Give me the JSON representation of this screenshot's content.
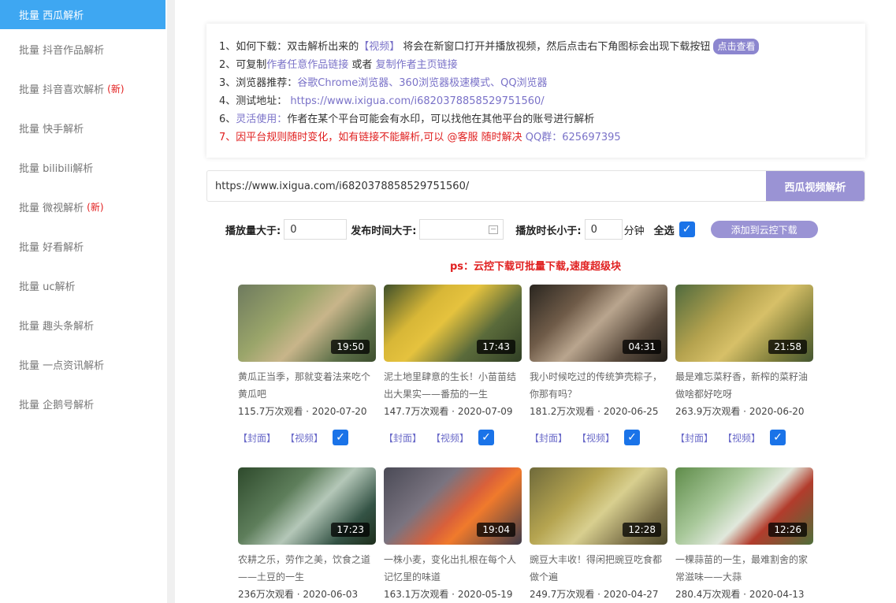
{
  "sidebar": {
    "items": [
      {
        "label": "批量 西瓜解析",
        "new": "",
        "active": true
      },
      {
        "label": "批量 抖音作品解析",
        "new": ""
      },
      {
        "label": "批量 抖音喜欢解析",
        "new": "(新)"
      },
      {
        "label": "批量 快手解析",
        "new": ""
      },
      {
        "label": "批量 bilibili解析",
        "new": ""
      },
      {
        "label": "批量 微视解析",
        "new": "(新)"
      },
      {
        "label": "批量 好看解析",
        "new": ""
      },
      {
        "label": "批量 uc解析",
        "new": ""
      },
      {
        "label": "批量 趣头条解析",
        "new": ""
      },
      {
        "label": "批量 一点资讯解析",
        "new": ""
      },
      {
        "label": "批量 企鹅号解析",
        "new": ""
      }
    ]
  },
  "notice": {
    "l1_a": "1、如何下载：双击解析出来的",
    "l1_link": "【视频】",
    "l1_b": " 将会在新窗口打开并播放视频，然后点击右下角图标会出现下载按钮",
    "l1_btn": "点击查看",
    "l2_a": "2、可复制",
    "l2_link1": "作者任意作品链接",
    "l2_b": " 或者 ",
    "l2_link2": "复制作者主页链接",
    "l3_a": "3、浏览器推荐：",
    "l3_link": "谷歌Chrome浏览器、360浏览器极速模式、QQ浏览器",
    "l4_a": "4、测试地址：",
    "l4_link": " https://www.ixigua.com/i6820378858529751560/",
    "l6_link": "灵活使用：",
    "l6_a": "6、",
    "l6_b": "作者在某个平台可能会有水印，可以找他在其他平台的账号进行解析",
    "l7_red": "7、因平台规则随时变化，如有链接不能解析,可以 @客服 随时解决",
    "l7_link": " QQ群：625697395"
  },
  "search": {
    "value": "https://www.ixigua.com/i6820378858529751560/",
    "button": "西瓜视频解析"
  },
  "filters": {
    "plays_label": "播放量大于:",
    "plays_value": "0",
    "date_label": "发布时间大于:",
    "date_value": "",
    "duration_label": "播放时长小于:",
    "duration_value": "0",
    "duration_unit": "分钟",
    "select_all": "全选",
    "cloud_button": "添加到云控下载"
  },
  "ps": "ps：云控下载可批量下载,速度超级块",
  "card_actions": {
    "cover": "【封面】",
    "video": "【视频】"
  },
  "videos": [
    {
      "title": "黄瓜正当季，那就变着法来吃个黄瓜吧",
      "duration": "19:50",
      "views": "115.7万次观看",
      "date": "2020-07-20",
      "checked": true
    },
    {
      "title": "泥土地里肆意的生长！小苗苗结出大果实——番茄的一生",
      "duration": "17:43",
      "views": "147.7万次观看",
      "date": "2020-07-09",
      "checked": true
    },
    {
      "title": "我小时候吃过的传统笋壳粽子，你那有吗？",
      "duration": "04:31",
      "views": "181.2万次观看",
      "date": "2020-06-25",
      "checked": true
    },
    {
      "title": "最是难忘菜籽香，新榨的菜籽油做啥都好吃呀",
      "duration": "21:58",
      "views": "263.9万次观看",
      "date": "2020-06-20",
      "checked": true
    },
    {
      "title": "农耕之乐，劳作之美，饮食之道——土豆的一生",
      "duration": "17:23",
      "views": "236万次观看",
      "date": "2020-06-03"
    },
    {
      "title": "一株小麦，变化出扎根在每个人记忆里的味道",
      "duration": "19:04",
      "views": "163.1万次观看",
      "date": "2020-05-19"
    },
    {
      "title": "豌豆大丰收！得闲把豌豆吃食都做个遍",
      "duration": "12:28",
      "views": "249.7万次观看",
      "date": "2020-04-27"
    },
    {
      "title": "一棵蒜苗的一生，最难割舍的家常滋味——大蒜",
      "duration": "12:26",
      "views": "280.4万次观看",
      "date": "2020-04-13"
    }
  ]
}
